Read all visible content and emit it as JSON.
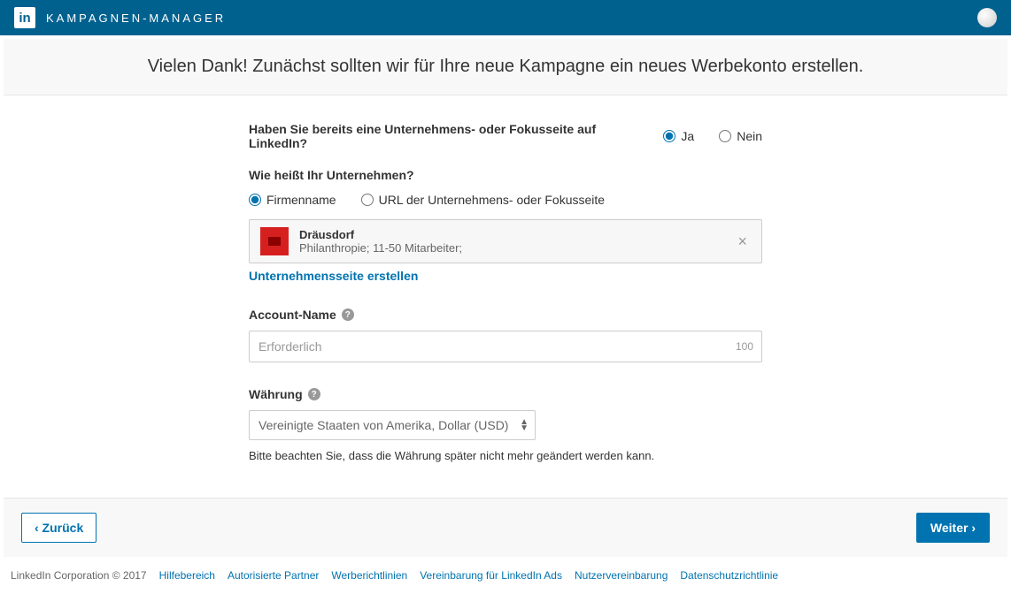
{
  "header": {
    "logo_text": "in",
    "app_title": "KAMPAGNEN-MANAGER"
  },
  "subheader": {
    "title": "Vielen Dank! Zunächst sollten wir für Ihre neue Kampagne ein neues Werbekonto erstellen."
  },
  "form": {
    "has_page_question": "Haben Sie bereits eine Unternehmens- oder Fokusseite auf LinkedIn?",
    "yes_label": "Ja",
    "no_label": "Nein",
    "company_name_question": "Wie heißt Ihr Unternehmen?",
    "by_name_label": "Firmenname",
    "by_url_label": "URL der Unternehmens- oder Fokusseite",
    "company": {
      "name": "Dräusdorf",
      "meta": "Philanthropie; 11-50 Mitarbeiter;"
    },
    "create_page_link": "Unternehmensseite erstellen",
    "account_name_label": "Account-Name",
    "account_name_placeholder": "Erforderlich",
    "account_name_count": "100",
    "currency_label": "Währung",
    "currency_value": "Vereinigte Staaten von Amerika, Dollar (USD)",
    "currency_note": "Bitte beachten Sie, dass die Währung später nicht mehr geändert werden kann."
  },
  "nav": {
    "back": "‹ Zurück",
    "next": "Weiter ›"
  },
  "footer": {
    "copyright": "LinkedIn Corporation © 2017",
    "links": [
      "Hilfebereich",
      "Autorisierte Partner",
      "Werberichtlinien",
      "Vereinbarung für LinkedIn Ads",
      "Nutzervereinbarung",
      "Datenschutzrichtlinie"
    ]
  }
}
